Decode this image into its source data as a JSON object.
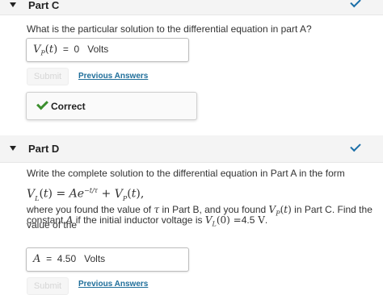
{
  "part_c": {
    "title": "Part C",
    "question": "What is the particular solution to the differential equation in part A?",
    "answer_value": "0",
    "answer_unit": "Volts",
    "submit_label": "Submit",
    "previous_answers_label": "Previous Answers",
    "feedback_label": "Correct"
  },
  "part_d": {
    "title": "Part D",
    "question": "Write the complete solution to the differential equation in Part A in the form",
    "body_line1_a": "where you found the value of",
    "body_line1_b": "in Part B, and you found",
    "body_line1_c": "in Part C.  Find the value of the",
    "body_line2_a": "constant",
    "body_line2_b": "if the initial inductor voltage is",
    "initial_voltage": "4.5",
    "initial_voltage_unit": "V",
    "answer_label": "A =",
    "answer_value": "4.50",
    "answer_unit": "Volts",
    "submit_label": "Submit",
    "previous_answers_label": "Previous Answers"
  },
  "colors": {
    "accent": "#1f6e9a",
    "correct": "#3c8f2e"
  },
  "icons": [
    "caret-down-icon",
    "checkmark-icon"
  ]
}
